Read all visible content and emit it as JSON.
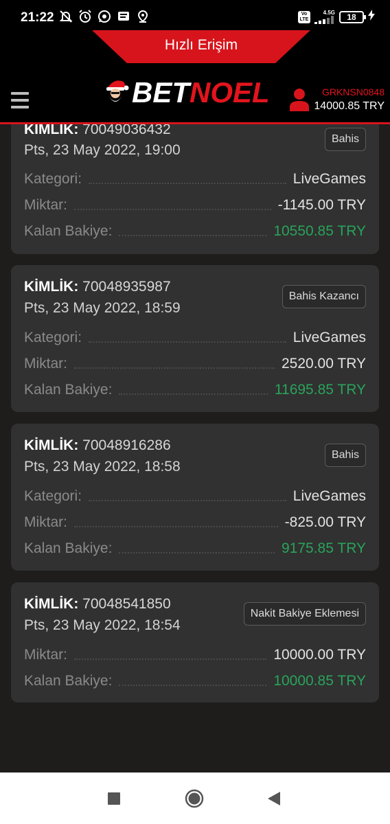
{
  "status_bar": {
    "time": "21:22",
    "icons_left": [
      "mute-notifications-icon",
      "alarm-icon",
      "whatsapp-icon",
      "message-icon",
      "location-icon"
    ],
    "network_label": "4.5G",
    "volte_label": "Vo LTE",
    "battery": "18"
  },
  "header": {
    "quick_access_label": "Hızlı Erişim",
    "logo_bet": "BET",
    "logo_noel": "NOEL",
    "username": "GRKNSN0848",
    "balance": "14000.85 TRY"
  },
  "colors": {
    "accent_red": "#d7141c",
    "positive_green": "#29a35a",
    "card_bg": "#313131",
    "page_bg": "#1f1c1c"
  },
  "labels": {
    "id_label": "KİMLİK:",
    "category": "Kategori:",
    "amount": "Miktar:",
    "remaining_balance": "Kalan Bakiye:"
  },
  "transactions": [
    {
      "id": "70049036432",
      "date": "Pts, 23 May 2022, 19:00",
      "type": "Bahis",
      "category": "LiveGames",
      "amount": "-1145.00 TRY",
      "remaining": "10550.85 TRY"
    },
    {
      "id": "70048935987",
      "date": "Pts, 23 May 2022, 18:59",
      "type": "Bahis Kazancı",
      "category": "LiveGames",
      "amount": "2520.00 TRY",
      "remaining": "11695.85 TRY"
    },
    {
      "id": "70048916286",
      "date": "Pts, 23 May 2022, 18:58",
      "type": "Bahis",
      "category": "LiveGames",
      "amount": "-825.00 TRY",
      "remaining": "9175.85 TRY"
    },
    {
      "id": "70048541850",
      "date": "Pts, 23 May 2022, 18:54",
      "type": "Nakit Bakiye Eklemesi",
      "amount": "10000.00 TRY",
      "remaining": "10000.85 TRY"
    }
  ],
  "nav": [
    "recents-button",
    "home-button",
    "back-button"
  ]
}
